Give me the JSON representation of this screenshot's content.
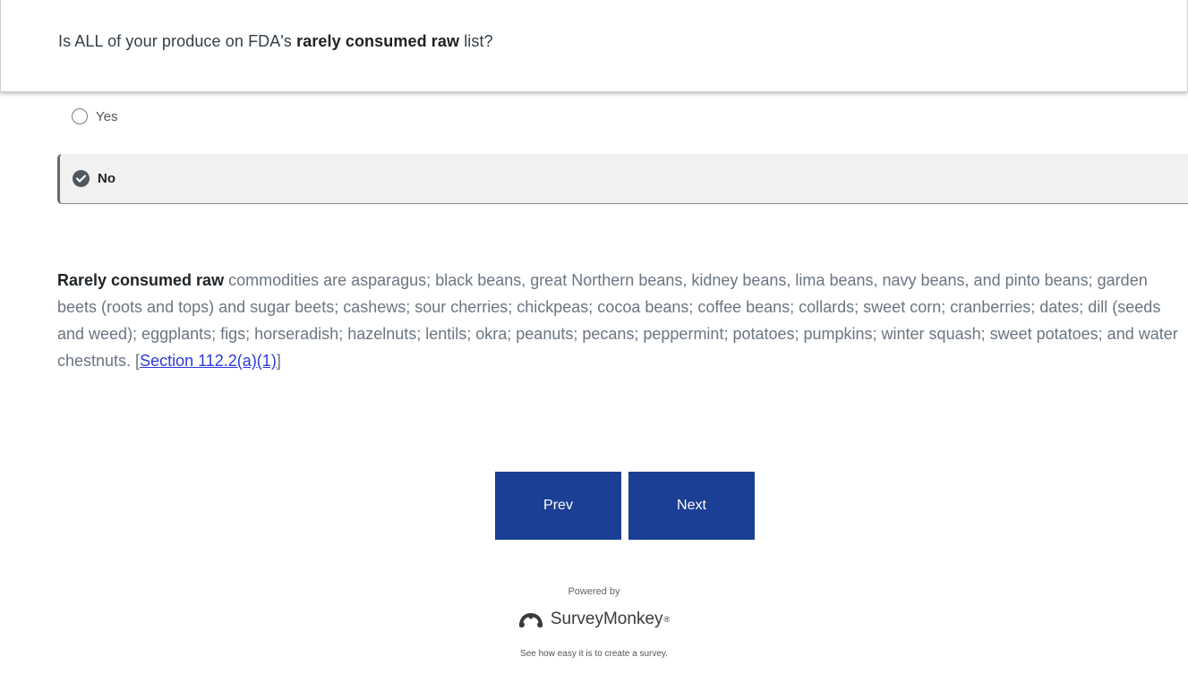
{
  "question": {
    "prefix": "Is ALL of your produce on FDA's ",
    "bold": "rarely consumed raw",
    "suffix": " list?"
  },
  "options": [
    {
      "label": "Yes",
      "selected": false
    },
    {
      "label": "No",
      "selected": true
    }
  ],
  "info": {
    "bold": "Rarely consumed raw",
    "text": " commodities are asparagus; black beans, great Northern beans, kidney beans, lima beans, navy beans, and pinto beans; garden beets (roots and tops) and sugar beets; cashews; sour cherries; chickpeas; cocoa beans; coffee beans; collards; sweet corn; cranberries; dates; dill (seeds and weed); eggplants; figs; horseradish; hazelnuts; lentils; okra; peanuts; pecans; peppermint; potatoes; pumpkins; winter squash; sweet potatoes; and water chestnuts. [",
    "link": "Section 112.2(a)(1)",
    "close": "]"
  },
  "buttons": {
    "prev": "Prev",
    "next": "Next"
  },
  "footer": {
    "powered_by": "Powered by",
    "brand": "SurveyMonkey",
    "tagline": "See how easy it is to create a survey."
  },
  "colors": {
    "button_bg": "#1b3f94",
    "link": "#2d3bd9"
  },
  "icons": {
    "checked": "checkmark-icon",
    "logo": "surveymonkey-logo-icon"
  }
}
